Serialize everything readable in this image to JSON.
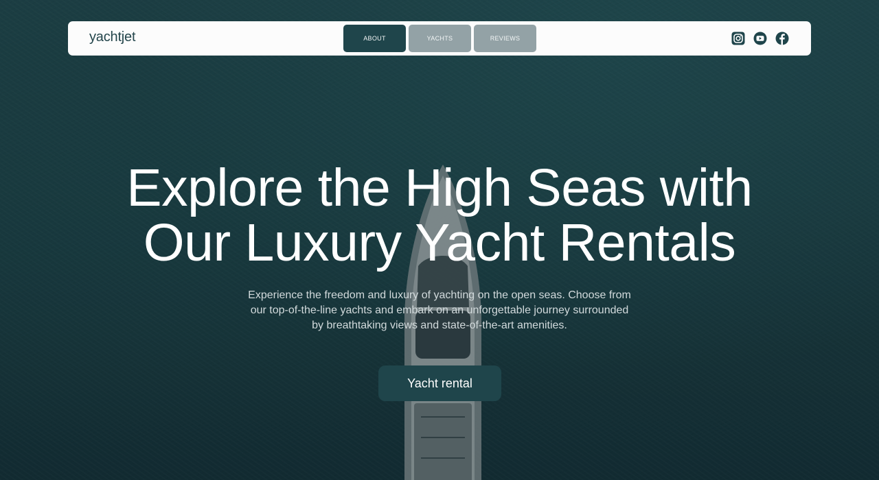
{
  "colors": {
    "accent": "#1f454b",
    "tab_inactive": "#93a2a6",
    "navbar_bg": "#fcfcfc",
    "hero_text": "#ffffff",
    "sub_text": "#d2dadc"
  },
  "navbar": {
    "brand": "yachtjet",
    "tabs": [
      {
        "label": "ABOUT",
        "active": true
      },
      {
        "label": "YACHTS",
        "active": false
      },
      {
        "label": "REVIEWS",
        "active": false
      }
    ],
    "socials": [
      {
        "icon": "instagram-icon"
      },
      {
        "icon": "youtube-icon"
      },
      {
        "icon": "facebook-icon"
      }
    ]
  },
  "hero": {
    "title_line1": "Explore the High Seas with",
    "title_line2": "Our Luxury Yacht Rentals",
    "subtitle_line1": "Experience the freedom and luxury of yachting on the open seas. Choose from",
    "subtitle_line2": "our top-of-the-line yachts and embark on an unforgettable journey surrounded",
    "subtitle_line3": "by breathtaking views and state-of-the-art amenities.",
    "cta_label": "Yacht rental"
  }
}
